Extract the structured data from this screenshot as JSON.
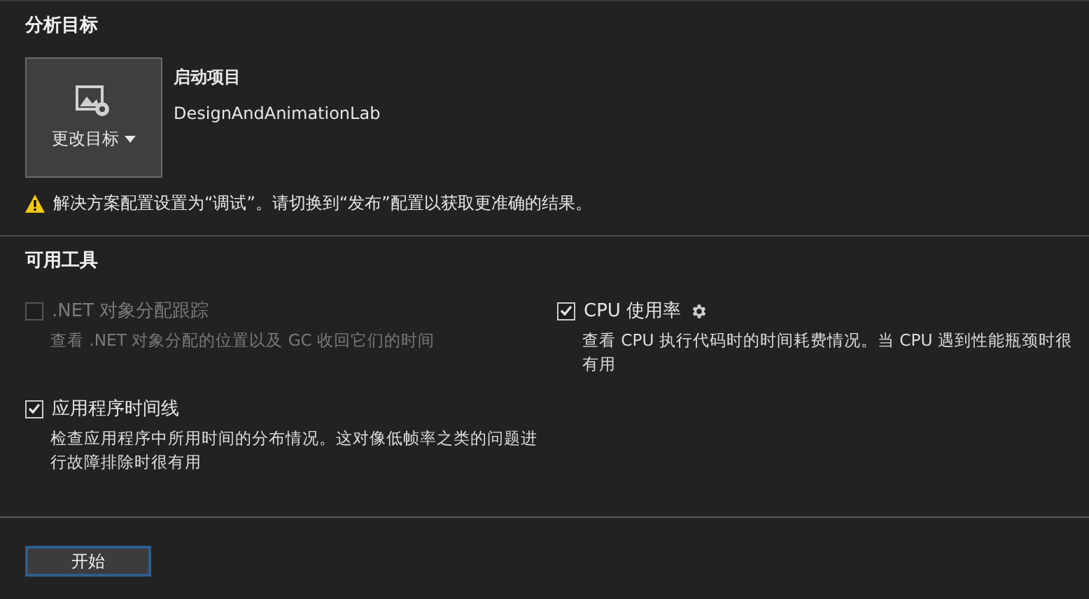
{
  "target_section": {
    "title": "分析目标",
    "target_button": {
      "label": "更改目标"
    },
    "startup": {
      "heading": "启动项目",
      "project": "DesignAndAnimationLab"
    },
    "warning": "解决方案配置设置为“调试”。请切换到“发布”配置以获取更准确的结果。"
  },
  "tools_section": {
    "title": "可用工具",
    "tools": [
      {
        "name": ".NET 对象分配跟踪",
        "description": "查看 .NET 对象分配的位置以及 GC 收回它们的时间",
        "checked": false,
        "disabled": true,
        "settings": false
      },
      {
        "name": "CPU 使用率",
        "description": "查看 CPU 执行代码时的时间耗费情况。当 CPU 遇到性能瓶颈时很有用",
        "checked": true,
        "disabled": false,
        "settings": true
      },
      {
        "name": "应用程序时间线",
        "description": "检查应用程序中所用时间的分布情况。这对像低帧率之类的问题进行故障排除时很有用",
        "checked": true,
        "disabled": false,
        "settings": false
      }
    ]
  },
  "start_button": {
    "label": "开始"
  }
}
